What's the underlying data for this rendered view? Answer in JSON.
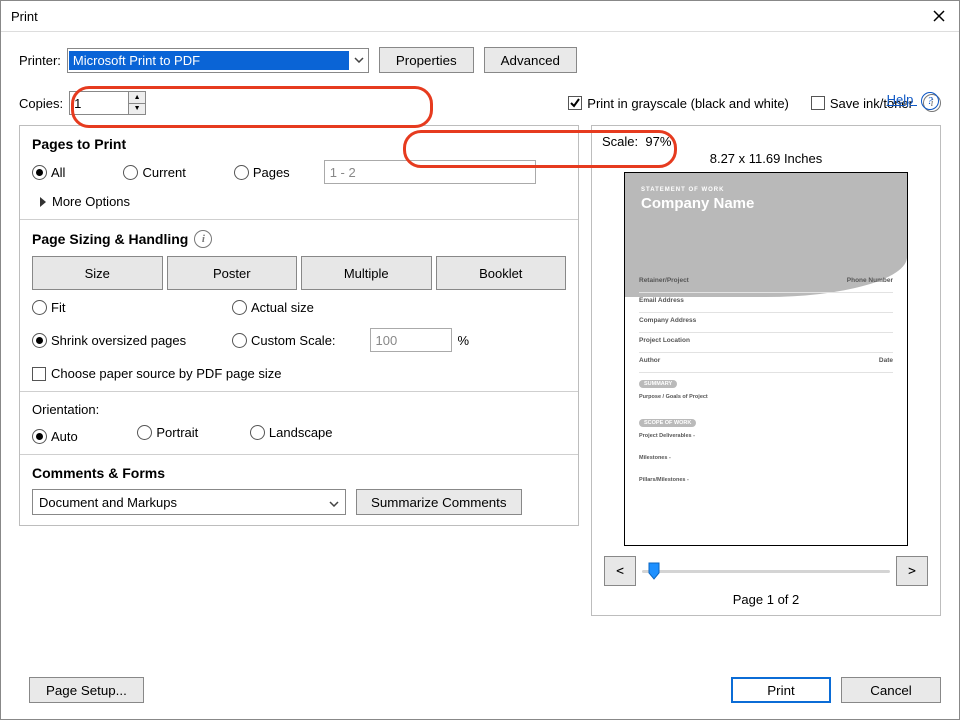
{
  "window": {
    "title": "Print"
  },
  "help": {
    "label": "Help"
  },
  "printer": {
    "label": "Printer:",
    "selected": "Microsoft Print to PDF",
    "properties": "Properties",
    "advanced": "Advanced"
  },
  "copies": {
    "label": "Copies:",
    "value": "1"
  },
  "grayscale": {
    "checked": true,
    "label": "Print in grayscale (black and white)"
  },
  "saveink": {
    "checked": false,
    "label": "Save ink/toner"
  },
  "pages": {
    "heading": "Pages to Print",
    "all": "All",
    "current": "Current",
    "pages": "Pages",
    "range": "1 - 2",
    "more": "More Options"
  },
  "sizing": {
    "heading": "Page Sizing & Handling",
    "size": "Size",
    "poster": "Poster",
    "multiple": "Multiple",
    "booklet": "Booklet",
    "fit": "Fit",
    "actual": "Actual size",
    "shrink": "Shrink oversized pages",
    "custom": "Custom Scale:",
    "custom_val": "100",
    "pct": "%",
    "choose_source": "Choose paper source by PDF page size"
  },
  "orientation": {
    "heading": "Orientation:",
    "auto": "Auto",
    "portrait": "Portrait",
    "landscape": "Landscape"
  },
  "comments": {
    "heading": "Comments & Forms",
    "selected": "Document and Markups",
    "summarize": "Summarize Comments"
  },
  "preview": {
    "scale_label": "Scale:",
    "scale_value": "97%",
    "dims": "8.27 x 11.69 Inches",
    "prev": "<",
    "next": ">",
    "page_status": "Page 1 of 2",
    "doc": {
      "sow": "STATEMENT OF WORK",
      "company": "Company Name",
      "retainer": "Retainer/Project",
      "phone": "Phone Number",
      "email": "Email Address",
      "addr": "Company Address",
      "loc": "Project Location",
      "author": "Author",
      "date": "Date",
      "summary_pill": "SUMMARY",
      "purpose": "Purpose / Goals of Project",
      "scope_pill": "SCOPE OF WORK",
      "deliv": "Project Deliverables -",
      "milestones": "Milestones -",
      "risks": "Pillars/Milestones -"
    }
  },
  "footer": {
    "page_setup": "Page Setup...",
    "print": "Print",
    "cancel": "Cancel"
  }
}
